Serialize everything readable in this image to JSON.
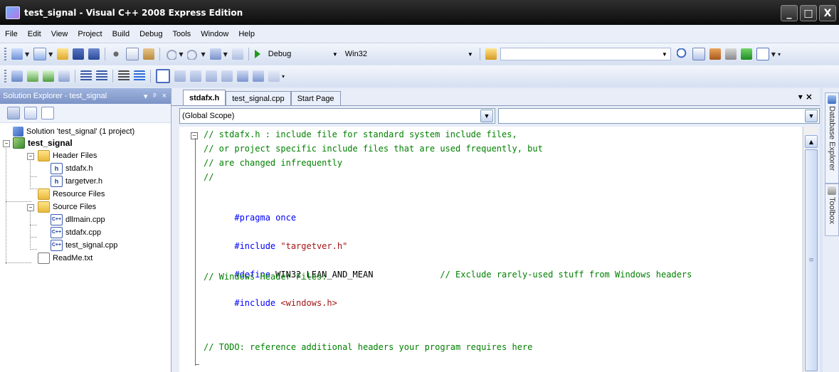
{
  "window": {
    "title": "test_signal - Visual C++ 2008 Express Edition",
    "buttons": [
      "_",
      "□",
      "X"
    ]
  },
  "menu": [
    "File",
    "Edit",
    "View",
    "Project",
    "Build",
    "Debug",
    "Tools",
    "Window",
    "Help"
  ],
  "toolbar": {
    "config": "Debug",
    "platform": "Win32",
    "find_value": ""
  },
  "solution_explorer": {
    "title": "Solution Explorer - test_signal",
    "header_buttons": [
      "▾",
      "ᵖ",
      "×"
    ],
    "solution": "Solution 'test_signal' (1 project)",
    "project": "test_signal",
    "header_folder": "Header Files",
    "header_files": [
      "stdafx.h",
      "targetver.h"
    ],
    "resource_folder": "Resource Files",
    "source_folder": "Source Files",
    "source_files": [
      "dllmain.cpp",
      "stdafx.cpp",
      "test_signal.cpp"
    ],
    "readme": "ReadMe.txt"
  },
  "tabs": [
    "stdafx.h",
    "test_signal.cpp",
    "Start Page"
  ],
  "scope": {
    "left": "(Global Scope)",
    "right": ""
  },
  "code": {
    "l1": "// stdafx.h : include file for standard system include files,",
    "l2": "// or project specific include files that are used frequently, but",
    "l3": "// are changed infrequently",
    "l4": "//",
    "pragma_kw": "#pragma",
    "pragma_rest": " once",
    "include_kw": "#include",
    "include1_str": " \"targetver.h\"",
    "define_kw": "#define",
    "define_rest": " WIN32_LEAN_AND_MEAN             ",
    "define_cmt": "// Exclude rarely-used stuff from Windows headers",
    "whf": "// Windows Header Files:",
    "include2_str": " <windows.h>",
    "todo": "// TODO: reference additional headers your program requires here"
  },
  "right_dock": [
    "Database Explorer",
    "Toolbox"
  ]
}
